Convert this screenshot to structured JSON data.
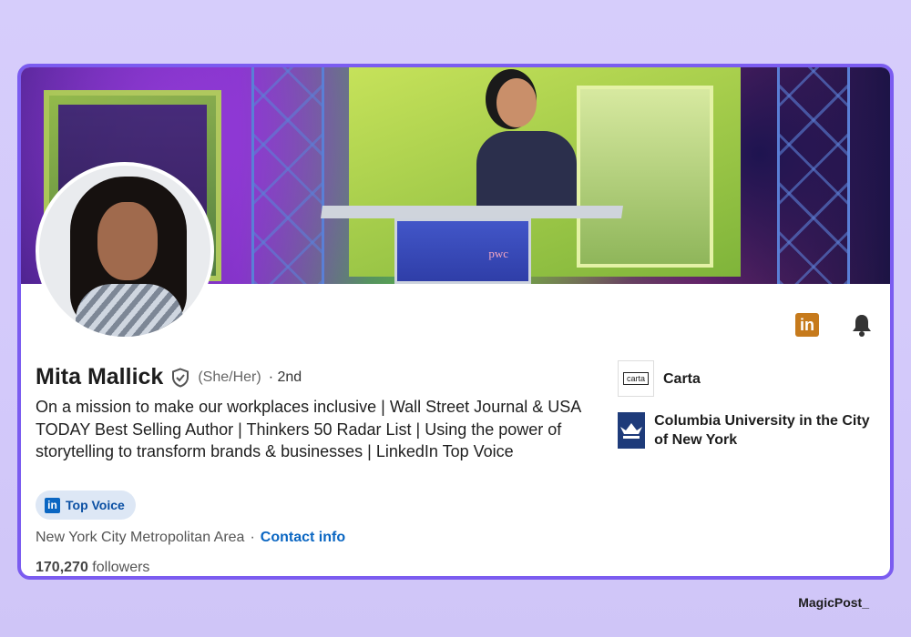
{
  "profile": {
    "name": "Mita Mallick",
    "pronouns": "(She/Her)",
    "degree": "· 2nd",
    "headline": "On a mission to make our workplaces inclusive | Wall Street Journal & USA TODAY Best Selling Author | Thinkers 50 Radar List | Using the power of storytelling to transform brands & businesses | LinkedIn Top Voice",
    "badge": "Top Voice",
    "location": "New York City Metropolitan Area",
    "separator": "·",
    "contact_label": "Contact info",
    "followers_count": "170,270",
    "followers_label": "followers"
  },
  "side": {
    "items": [
      {
        "name": "Carta",
        "logo_text": "carta"
      },
      {
        "name": "Columbia University in the City of New York",
        "logo_text": ""
      }
    ]
  },
  "banner": {
    "podium_brand": "pwc"
  },
  "icons": {
    "linkedin": "linkedin-icon",
    "bell": "bell-icon",
    "verified": "shield-check-icon"
  },
  "watermark": "MagicPost_",
  "colors": {
    "accent_border": "#7b5cf0",
    "link": "#0a66c2",
    "linkedin_orange": "#c67a1c",
    "badge_bg": "#dde7f5"
  }
}
